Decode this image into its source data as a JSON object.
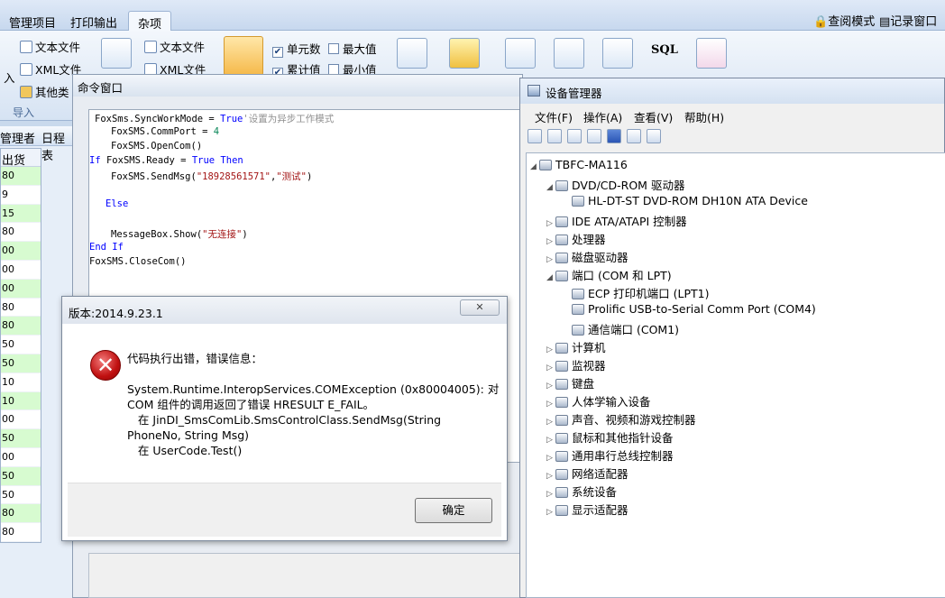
{
  "ribbon": {
    "tabs": [
      "管理项目",
      "打印输出",
      "杂项"
    ],
    "right_links": [
      "查阅模式",
      "记录窗口"
    ],
    "items": [
      "文本文件",
      "XML文件",
      "其他类",
      "文本文件",
      "XML文件",
      "单元数",
      "最大值",
      "累计值",
      "最小值",
      "SQL"
    ],
    "partial_left": [
      "入"
    ],
    "group_label": "导入"
  },
  "left": {
    "nav": [
      "管理者",
      "日程表"
    ],
    "column": "出货",
    "rows": [
      "80",
      "9",
      "15",
      "80",
      "00",
      "00",
      "00",
      "80",
      "80",
      "50",
      "50",
      "10",
      "10",
      "00",
      "50",
      "00",
      "50",
      "50",
      "80",
      "80"
    ]
  },
  "cmd_window": {
    "title": "命令窗口",
    "code": {
      "l1_a": "FoxSms.SyncWorkMode = ",
      "l1_kw": "True",
      "l1_cm": "'设置为异步工作模式",
      "l2_a": "FoxSMS.CommPort = ",
      "l2_num": "4",
      "l3": "FoxSMS.OpenCom()",
      "l4_kw1": "If",
      "l4_a": " FoxSMS.Ready = ",
      "l4_kw2": "True Then",
      "l5_a": "FoxSMS.SendMsg(",
      "l5_s1": "\"18928561571\"",
      "l5_c": ",",
      "l5_s2": "\"测试\"",
      "l5_b": ")",
      "l6": "Else",
      "l7_a": "MessageBox.Show(",
      "l7_s": "\"无连接\"",
      "l7_b": ")",
      "l8": "End If",
      "l9": "FoxSMS.CloseCom()"
    }
  },
  "devmgr": {
    "title": "设备管理器",
    "menu": [
      "文件(F)",
      "操作(A)",
      "查看(V)",
      "帮助(H)"
    ],
    "tree": [
      {
        "label": "TBFC-MA116",
        "icon": "computer-icon"
      },
      {
        "label": "DVD/CD-ROM 驱动器",
        "icon": "dvd-icon"
      },
      {
        "label": "HL-DT-ST DVD-ROM DH10N ATA Device",
        "icon": "dvd-icon"
      },
      {
        "label": "IDE ATA/ATAPI 控制器",
        "icon": "ide-icon"
      },
      {
        "label": "处理器",
        "icon": "cpu-icon"
      },
      {
        "label": "磁盘驱动器",
        "icon": "disk-icon"
      },
      {
        "label": "端口 (COM 和 LPT)",
        "icon": "port-icon"
      },
      {
        "label": "ECP 打印机端口 (LPT1)",
        "icon": "port-icon"
      },
      {
        "label": "Prolific USB-to-Serial Comm Port (COM4)",
        "icon": "port-icon"
      },
      {
        "label": "通信端口 (COM1)",
        "icon": "port-icon"
      },
      {
        "label": "计算机",
        "icon": "computer-icon"
      },
      {
        "label": "监视器",
        "icon": "monitor-icon"
      },
      {
        "label": "键盘",
        "icon": "keyboard-icon"
      },
      {
        "label": "人体学输入设备",
        "icon": "hid-icon"
      },
      {
        "label": "声音、视频和游戏控制器",
        "icon": "sound-icon"
      },
      {
        "label": "鼠标和其他指针设备",
        "icon": "mouse-icon"
      },
      {
        "label": "通用串行总线控制器",
        "icon": "usb-icon"
      },
      {
        "label": "网络适配器",
        "icon": "network-icon"
      },
      {
        "label": "系统设备",
        "icon": "system-icon"
      },
      {
        "label": "显示适配器",
        "icon": "display-icon"
      }
    ]
  },
  "dialog": {
    "title": "版本:2014.9.23.1",
    "heading": "代码执行出错，错误信息：",
    "lines": [
      "System.Runtime.InteropServices.COMException (0x80004005): 对",
      "COM 组件的调用返回了错误 HRESULT E_FAIL。",
      "   在 JinDI_SmsComLib.SmsControlClass.SendMsg(String",
      "PhoneNo, String Msg)",
      "   在 UserCode.Test()"
    ],
    "ok_label": "确定",
    "close_glyph": "✕"
  }
}
